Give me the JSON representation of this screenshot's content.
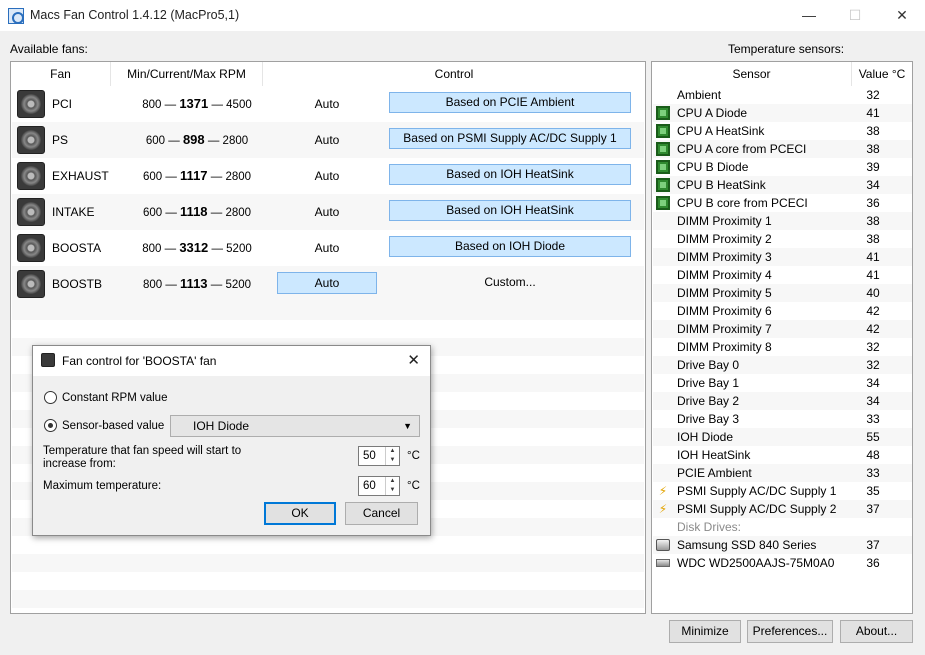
{
  "window": {
    "title": "Macs Fan Control 1.4.12 (MacPro5,1)",
    "minimize": "—",
    "maximize": "☐",
    "close": "✕"
  },
  "fans_panel": {
    "label": "Available fans:",
    "headers": {
      "fan": "Fan",
      "rpm": "Min/Current/Max RPM",
      "control": "Control"
    },
    "fans": [
      {
        "name": "PCI",
        "min": "800",
        "current": "1371",
        "max": "4500",
        "mode": "Auto",
        "control": "Based on PCIE Ambient"
      },
      {
        "name": "PS",
        "min": "600",
        "current": "898",
        "max": "2800",
        "mode": "Auto",
        "control": "Based on PSMI Supply AC/DC Supply 1"
      },
      {
        "name": "EXHAUST",
        "min": "600",
        "current": "1117",
        "max": "2800",
        "mode": "Auto",
        "control": "Based on IOH HeatSink"
      },
      {
        "name": "INTAKE",
        "min": "600",
        "current": "1118",
        "max": "2800",
        "mode": "Auto",
        "control": "Based on IOH HeatSink"
      },
      {
        "name": "BOOSTA",
        "min": "800",
        "current": "3312",
        "max": "5200",
        "mode": "Auto",
        "control": "Based on IOH Diode"
      },
      {
        "name": "BOOSTB",
        "min": "800",
        "current": "1113",
        "max": "5200",
        "mode": "Auto",
        "control": "Custom..."
      }
    ],
    "dash": "—"
  },
  "sensors_panel": {
    "label": "Temperature sensors:",
    "headers": {
      "sensor": "Sensor",
      "value": "Value °C"
    },
    "sensors": [
      {
        "name": "Ambient",
        "value": "32",
        "icon": "none"
      },
      {
        "name": "CPU A Diode",
        "value": "41",
        "icon": "chip-icon"
      },
      {
        "name": "CPU A HeatSink",
        "value": "38",
        "icon": "chip-icon"
      },
      {
        "name": "CPU A core from PCECI",
        "value": "38",
        "icon": "chip-icon"
      },
      {
        "name": "CPU B Diode",
        "value": "39",
        "icon": "chip-icon"
      },
      {
        "name": "CPU B HeatSink",
        "value": "34",
        "icon": "chip-icon"
      },
      {
        "name": "CPU B core from PCECI",
        "value": "36",
        "icon": "chip-icon"
      },
      {
        "name": "DIMM Proximity 1",
        "value": "38",
        "icon": "none"
      },
      {
        "name": "DIMM Proximity 2",
        "value": "38",
        "icon": "none"
      },
      {
        "name": "DIMM Proximity 3",
        "value": "41",
        "icon": "none"
      },
      {
        "name": "DIMM Proximity 4",
        "value": "41",
        "icon": "none"
      },
      {
        "name": "DIMM Proximity 5",
        "value": "40",
        "icon": "none"
      },
      {
        "name": "DIMM Proximity 6",
        "value": "42",
        "icon": "none"
      },
      {
        "name": "DIMM Proximity 7",
        "value": "42",
        "icon": "none"
      },
      {
        "name": "DIMM Proximity 8",
        "value": "32",
        "icon": "none"
      },
      {
        "name": "Drive Bay 0",
        "value": "32",
        "icon": "none"
      },
      {
        "name": "Drive Bay 1",
        "value": "34",
        "icon": "none"
      },
      {
        "name": "Drive Bay 2",
        "value": "34",
        "icon": "none"
      },
      {
        "name": "Drive Bay 3",
        "value": "33",
        "icon": "none"
      },
      {
        "name": "IOH Diode",
        "value": "55",
        "icon": "none"
      },
      {
        "name": "IOH HeatSink",
        "value": "48",
        "icon": "none"
      },
      {
        "name": "PCIE Ambient",
        "value": "33",
        "icon": "none"
      },
      {
        "name": "PSMI Supply AC/DC Supply 1",
        "value": "35",
        "icon": "lightning-icon"
      },
      {
        "name": "PSMI Supply AC/DC Supply 2",
        "value": "37",
        "icon": "lightning-icon"
      },
      {
        "name": "Disk Drives:",
        "value": "",
        "icon": "none",
        "group": true
      },
      {
        "name": "Samsung SSD 840 Series",
        "value": "37",
        "icon": "ssd-icon"
      },
      {
        "name": "WDC WD2500AAJS-75M0A0",
        "value": "36",
        "icon": "hdd-icon"
      }
    ]
  },
  "buttons": {
    "minimize": "Minimize",
    "preferences": "Preferences...",
    "about": "About..."
  },
  "dialog": {
    "title": "Fan control for 'BOOSTA' fan",
    "close": "✕",
    "option_constant": "Constant RPM value",
    "option_sensor": "Sensor-based value",
    "selected_option": "sensor",
    "sensor_selected": "IOH Diode",
    "start_temp_label_line1": "Temperature that fan speed will start to",
    "start_temp_label_line2": "increase from:",
    "start_temp_value": "50",
    "max_temp_label": "Maximum temperature:",
    "max_temp_value": "60",
    "unit": "°C",
    "ok": "OK",
    "cancel": "Cancel"
  }
}
